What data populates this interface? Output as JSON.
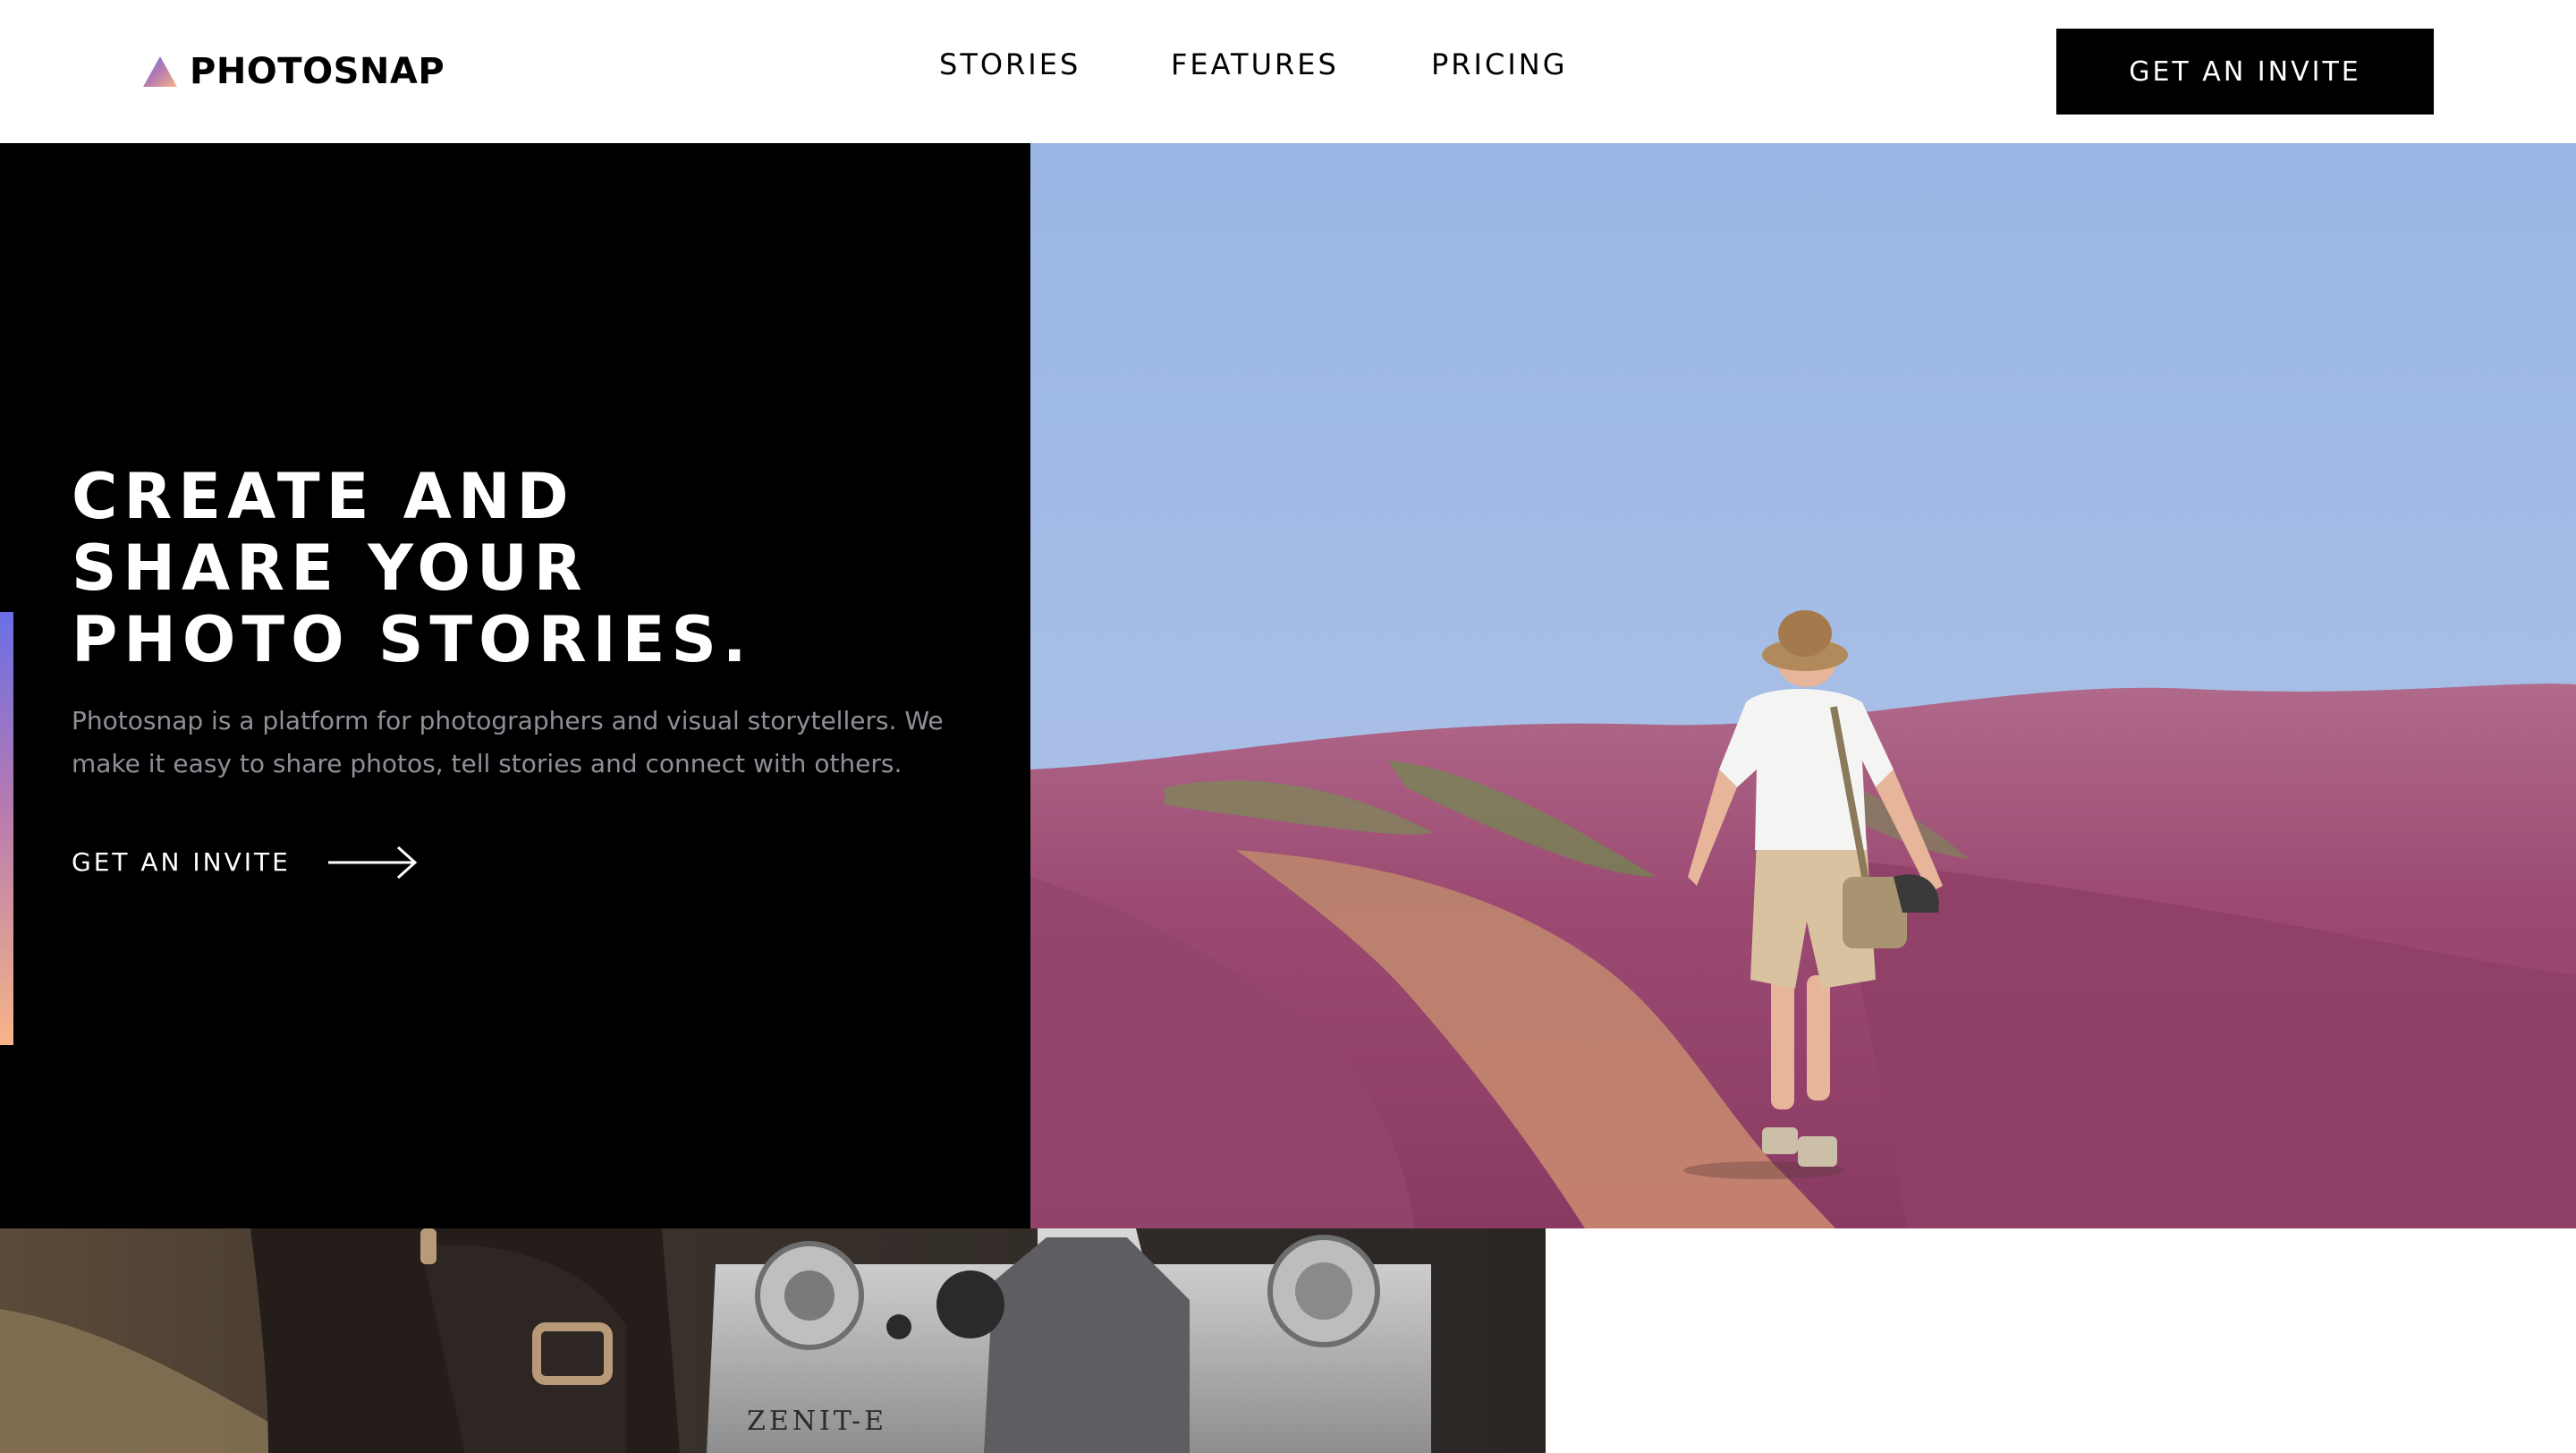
{
  "header": {
    "logo_text": "PHOTOSNAP",
    "nav": [
      {
        "label": "STORIES"
      },
      {
        "label": "FEATURES"
      },
      {
        "label": "PRICING"
      }
    ],
    "cta_label": "GET AN INVITE"
  },
  "hero": {
    "title_lines": [
      "CREATE AND",
      "SHARE YOUR",
      "PHOTO STORIES."
    ],
    "description": "Photosnap is a platform for photographers and visual storytellers. We make it easy to share photos, tell stories and connect with others.",
    "cta_label": "GET AN INVITE",
    "accent_gradient": [
      "#6a6fe6",
      "#b77ab0",
      "#f5b587"
    ]
  },
  "camera": {
    "brand_text": "ZENIT-E"
  },
  "colors": {
    "black": "#000000",
    "white": "#ffffff",
    "muted_text": "#8f8f99"
  },
  "icons": {
    "logo": "triangle-gradient-icon",
    "cta_arrow": "arrow-right-icon"
  }
}
